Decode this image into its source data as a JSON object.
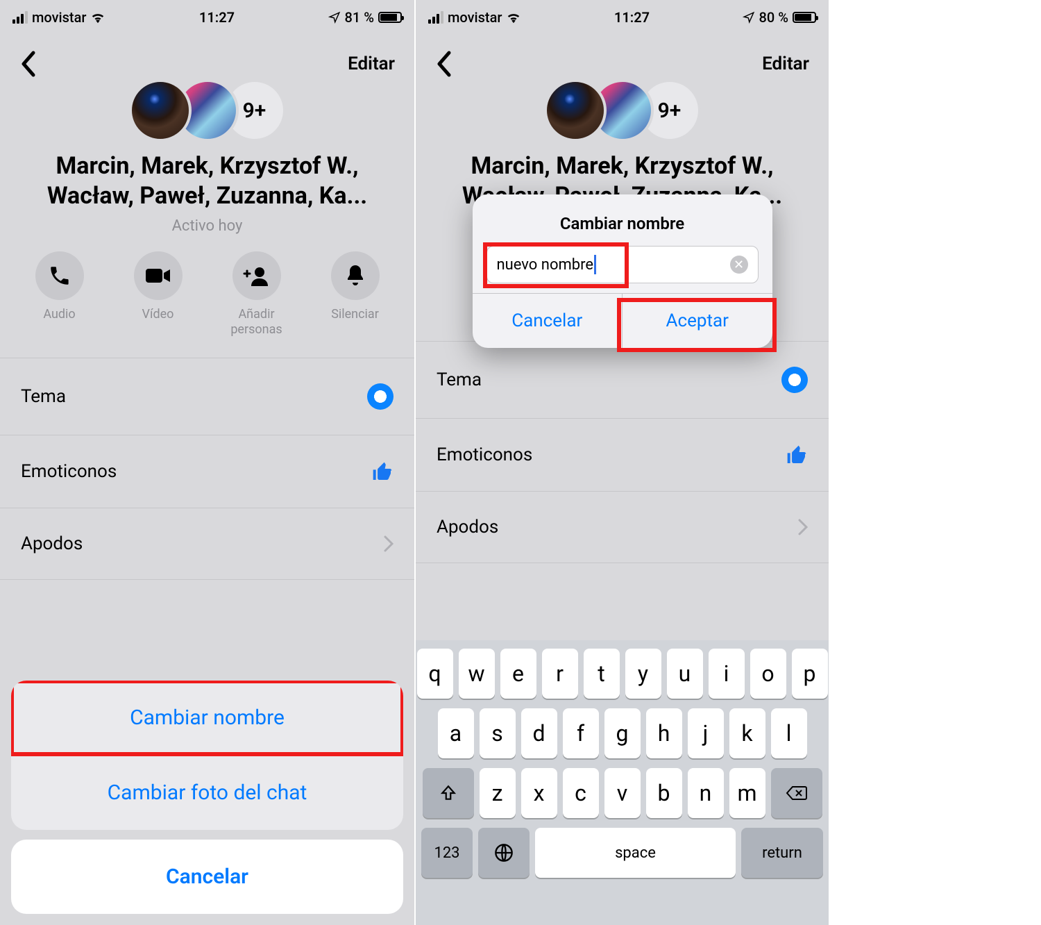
{
  "left": {
    "status": {
      "carrier": "movistar",
      "time": "11:27",
      "battery_pct": "81 %"
    },
    "nav": {
      "edit": "Editar"
    },
    "avatars": {
      "overflow": "9+"
    },
    "group_name": "Marcin, Marek, Krzysztof W., Wacław, Paweł, Zuzanna, Ka...",
    "active": "Activo hoy",
    "actions": {
      "audio": "Audio",
      "video": "Vídeo",
      "add": "Añadir personas",
      "mute": "Silenciar"
    },
    "list": {
      "theme": "Tema",
      "emoji": "Emoticonos",
      "nicknames": "Apodos"
    },
    "sheet": {
      "change_name": "Cambiar nombre",
      "change_photo": "Cambiar foto del chat",
      "cancel": "Cancelar"
    }
  },
  "right": {
    "status": {
      "carrier": "movistar",
      "time": "11:27",
      "battery_pct": "80 %"
    },
    "nav": {
      "edit": "Editar"
    },
    "avatars": {
      "overflow": "9+"
    },
    "group_name": "Marcin, Marek, Krzysztof W., Wacław, Paweł, Zuzanna, Ka...",
    "alert": {
      "title": "Cambiar nombre",
      "input_value": "nuevo nombre",
      "cancel": "Cancelar",
      "accept": "Aceptar"
    },
    "list": {
      "theme": "Tema",
      "emoji": "Emoticonos",
      "nicknames": "Apodos"
    },
    "keyboard": {
      "row1": [
        "q",
        "w",
        "e",
        "r",
        "t",
        "y",
        "u",
        "i",
        "o",
        "p"
      ],
      "row2": [
        "a",
        "s",
        "d",
        "f",
        "g",
        "h",
        "j",
        "k",
        "l"
      ],
      "row3": [
        "z",
        "x",
        "c",
        "v",
        "b",
        "n",
        "m"
      ],
      "num": "123",
      "space": "space",
      "return": "return"
    }
  }
}
